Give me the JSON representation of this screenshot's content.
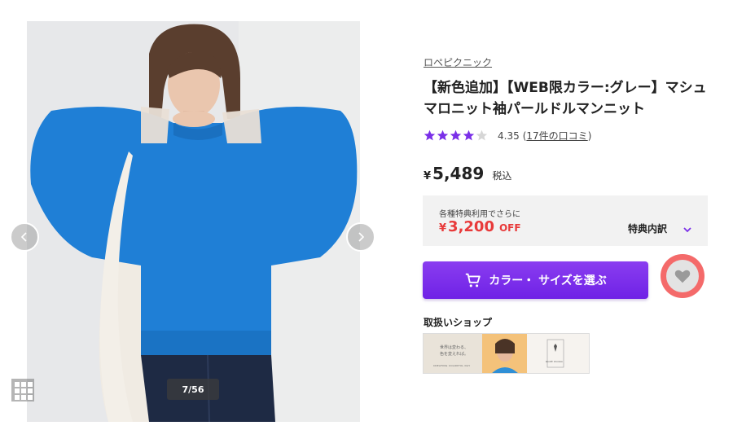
{
  "gallery": {
    "counter": "7/56",
    "prev_icon": "chevron-left-icon",
    "next_icon": "chevron-right-icon",
    "grid_icon": "grid-icon"
  },
  "product": {
    "brand": "ロペピクニック",
    "title": "【新色追加】【WEB限カラー:グレー】マシュマロニット袖パールドルマンニット",
    "rating": {
      "score": "4.35",
      "stars": 4.35,
      "reviews_link": "17件の口コミ",
      "open_paren": "(",
      "close_paren": ")"
    },
    "price": {
      "yen": "¥",
      "amount": "5,489",
      "tax": "税込"
    },
    "benefit": {
      "note": "各種特典利用でさらに",
      "yen": "¥",
      "amount": "3,200",
      "off": "OFF",
      "detail_label": "特典内訳"
    },
    "cart_button_label": "カラー・ サイズを選ぶ",
    "shop_label": "取扱いショップ",
    "banner": {
      "line1": "世界は変わる、",
      "line2": "色を変えれば。",
      "tagline": "CREATING COLORFUL DAY",
      "logo": "ROPÉ PICNIC"
    }
  },
  "colors": {
    "accent": "#7a2fe8",
    "sale_red": "#e83a3a",
    "favorite_ring": "#f46a6a",
    "sweater": "#1f7fd6"
  }
}
